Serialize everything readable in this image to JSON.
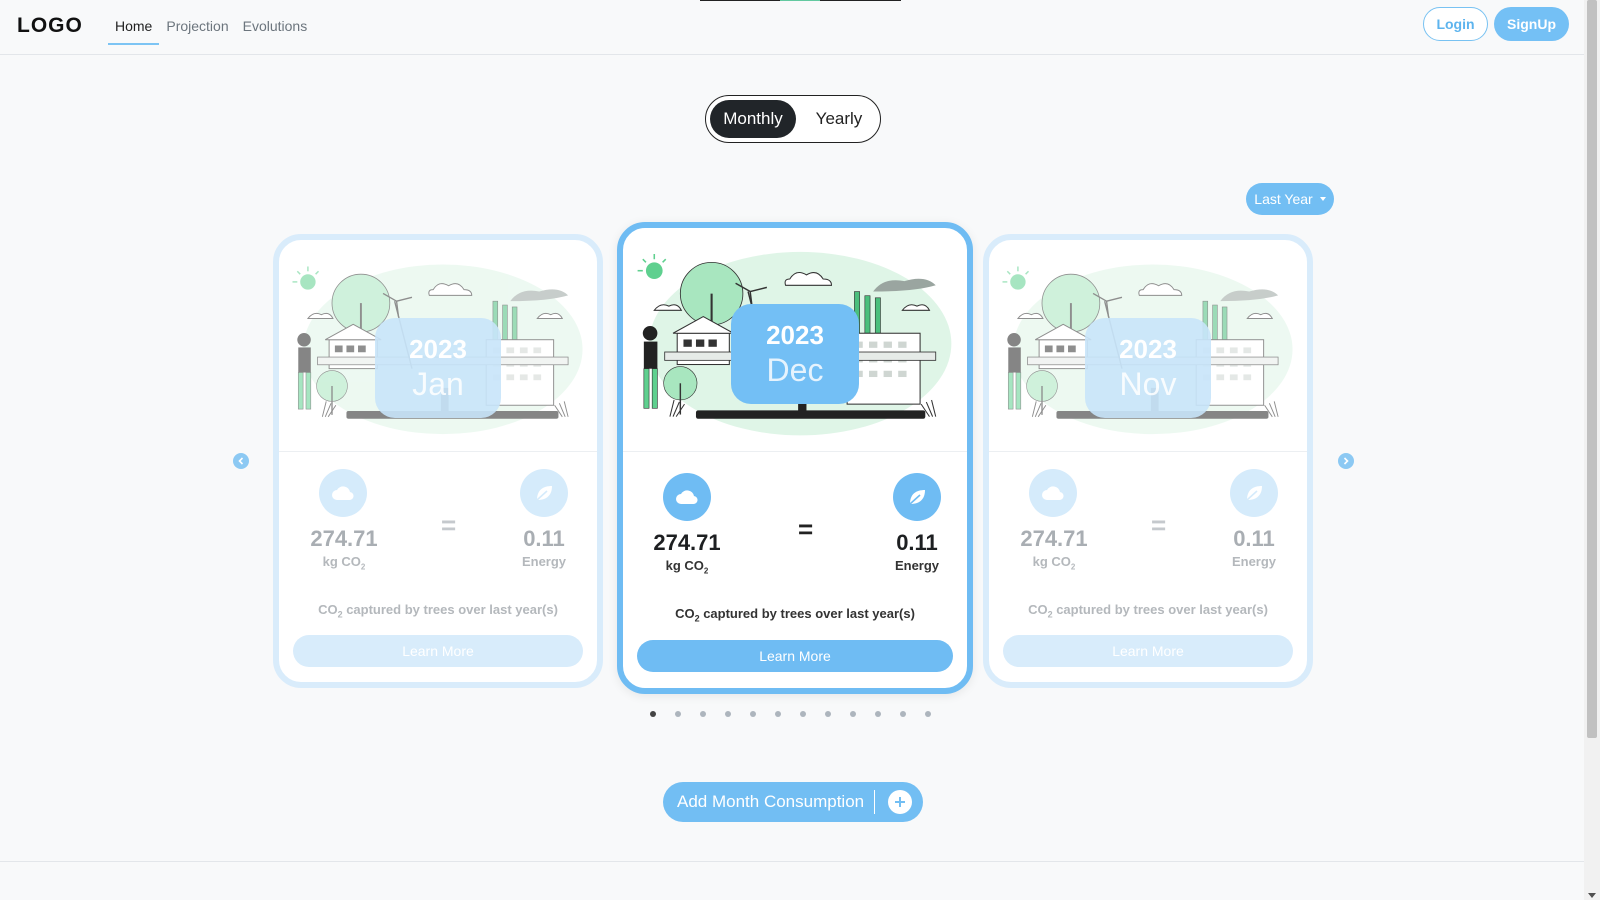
{
  "nav": {
    "logo": "LOGO",
    "links": [
      "Home",
      "Projection",
      "Evolutions"
    ],
    "active": "Home",
    "login": "Login",
    "signup": "SignUp"
  },
  "toggle": {
    "monthly": "Monthly",
    "yearly": "Yearly",
    "selected": "Monthly"
  },
  "filter": {
    "label": "Last Year"
  },
  "cards": [
    {
      "year": "2023",
      "month": "Jan",
      "co2_value": "274.71",
      "co2_unit": "kg CO",
      "co2_sub": "2",
      "energy_value": "0.11",
      "energy_unit": "Energy",
      "caption_pre": "CO",
      "caption_sub": "2",
      "caption_post": " captured by trees over last year(s)",
      "button": "Learn More",
      "active": false
    },
    {
      "year": "2023",
      "month": "Dec",
      "co2_value": "274.71",
      "co2_unit": "kg CO",
      "co2_sub": "2",
      "energy_value": "0.11",
      "energy_unit": "Energy",
      "caption_pre": "CO",
      "caption_sub": "2",
      "caption_post": " captured by trees over last year(s)",
      "button": "Learn More",
      "active": true
    },
    {
      "year": "2023",
      "month": "Nov",
      "co2_value": "274.71",
      "co2_unit": "kg CO",
      "co2_sub": "2",
      "energy_value": "0.11",
      "energy_unit": "Energy",
      "caption_pre": "CO",
      "caption_sub": "2",
      "caption_post": " captured by trees over last year(s)",
      "button": "Learn More",
      "active": false
    }
  ],
  "carousel": {
    "total_slides": 12,
    "active_index": 0
  },
  "add_button": {
    "label": "Add Month Consumption"
  },
  "icons": {
    "co2": "cloud-icon",
    "energy": "leaf-icon",
    "prev": "chevron-left-icon",
    "next": "chevron-right-icon",
    "add": "plus-icon"
  },
  "colors": {
    "accent": "#72bef3",
    "accent_light": "#d8ecfb",
    "dark": "#212529"
  }
}
